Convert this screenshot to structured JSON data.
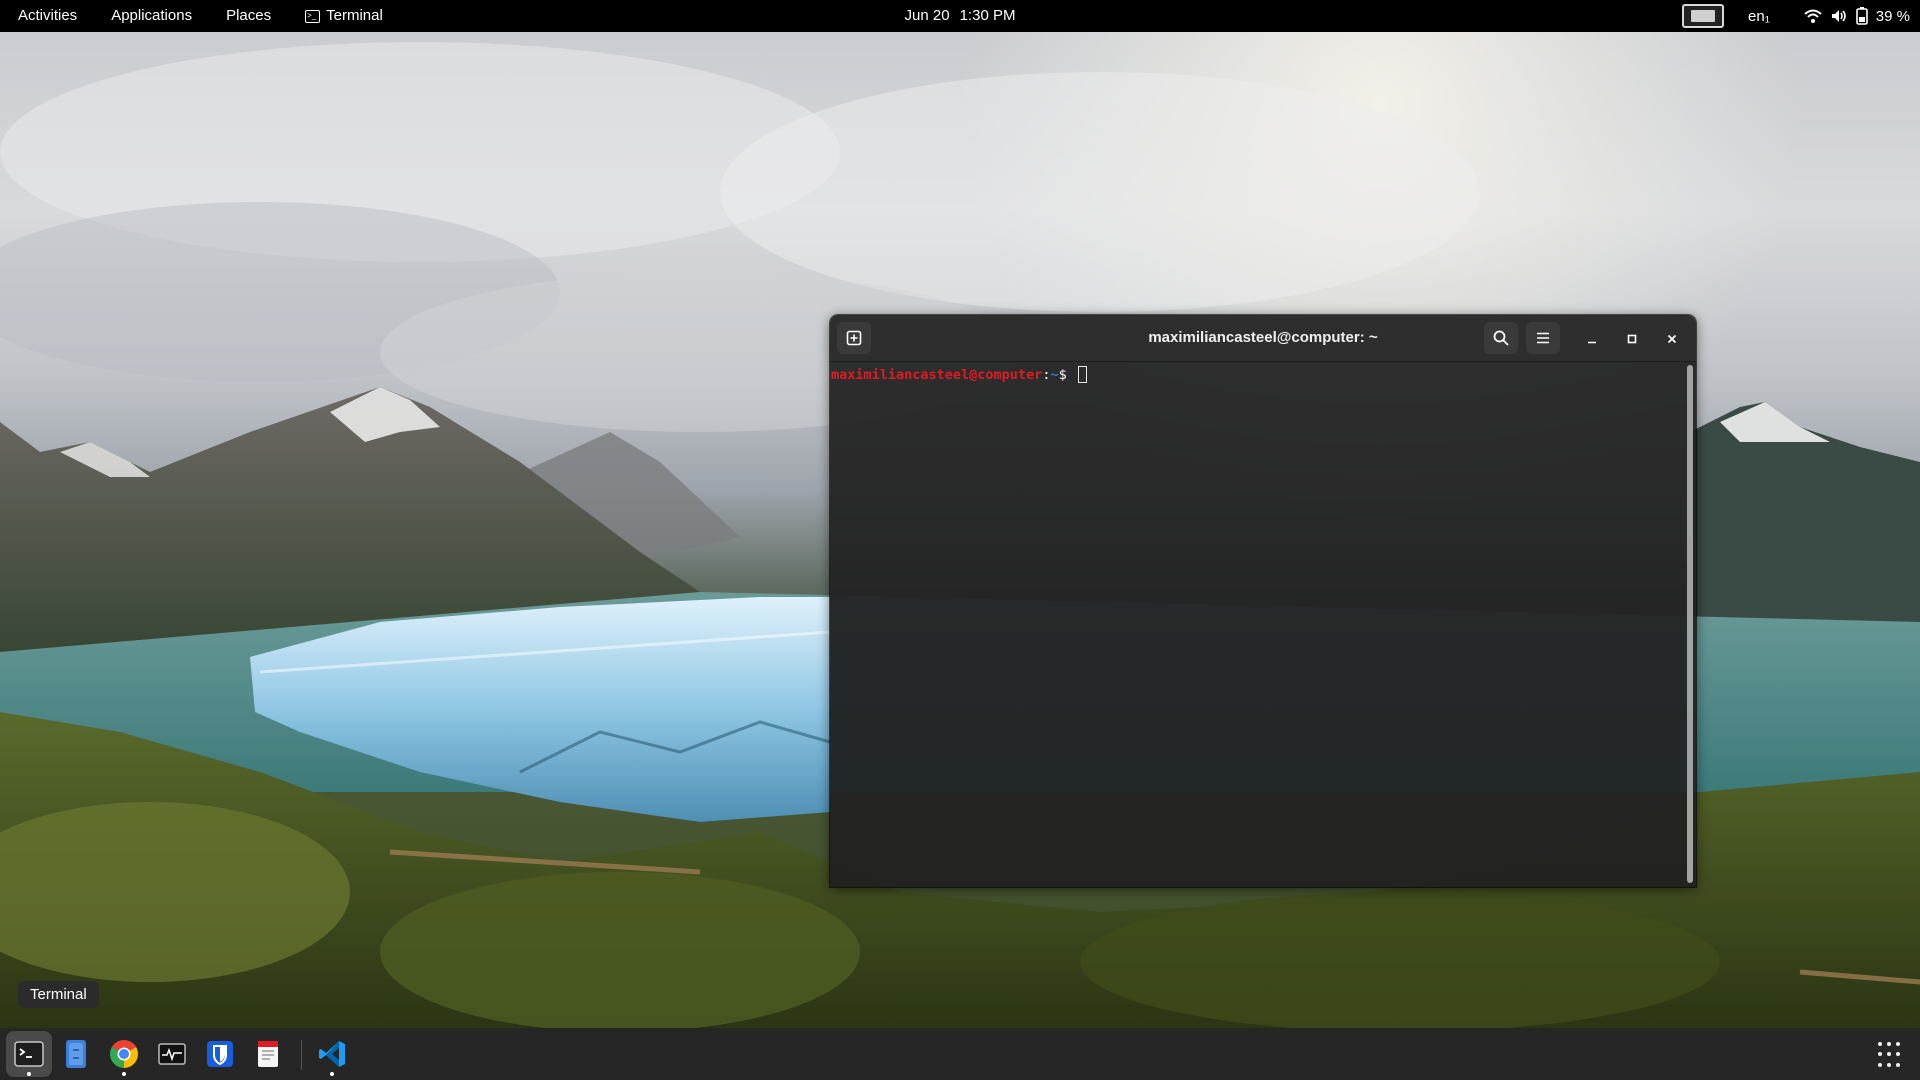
{
  "topbar": {
    "activities": "Activities",
    "applications": "Applications",
    "places": "Places",
    "app_name": "Terminal",
    "date": "Jun 20",
    "time": "1:30 PM",
    "language": "en₁",
    "battery": "39 %",
    "icons": [
      "screen-indicator-icon",
      "wifi-icon",
      "volume-icon",
      "battery-icon"
    ]
  },
  "terminal": {
    "title": "maximiliancasteel@computer: ~",
    "prompt_user": "maximiliancasteel@computer",
    "prompt_sep": ":",
    "prompt_path": "~",
    "prompt_dollar": "$ ",
    "icons": [
      "new-tab-icon",
      "search-icon",
      "menu-icon",
      "minimize-icon",
      "maximize-icon",
      "close-icon"
    ]
  },
  "tooltip": {
    "text": "Terminal"
  },
  "dock": {
    "items": [
      {
        "name": "Terminal",
        "icon": "terminal-icon",
        "active": true,
        "running": true
      },
      {
        "name": "Files",
        "icon": "files-icon",
        "active": false,
        "running": false
      },
      {
        "name": "Google Chrome",
        "icon": "chrome-icon",
        "active": false,
        "running": true
      },
      {
        "name": "System Monitor",
        "icon": "system-monitor-icon",
        "active": false,
        "running": false
      },
      {
        "name": "Bitwarden",
        "icon": "bitwarden-icon",
        "active": false,
        "running": false
      },
      {
        "name": "Document Viewer",
        "icon": "document-viewer-icon",
        "active": false,
        "running": false
      },
      {
        "name": "Visual Studio Code",
        "icon": "vscode-icon",
        "active": false,
        "running": true
      }
    ],
    "apps_grid_icon": "show-applications-icon"
  },
  "colors": {
    "prompt_user": "#e01b24",
    "prompt_path": "#2a7bde",
    "terminal_bg": "#202020",
    "header_bg": "#2e2e2e",
    "dock_bg": "#262626"
  }
}
